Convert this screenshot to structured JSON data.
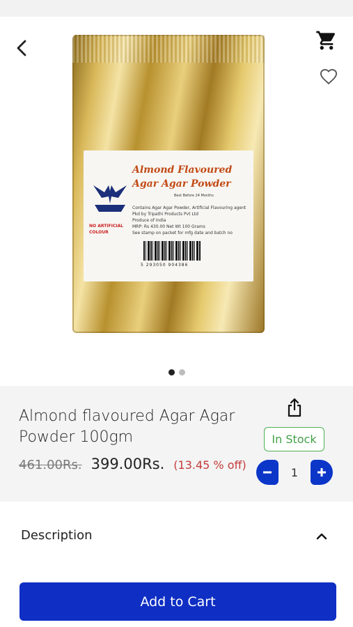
{
  "product": {
    "title": "Almond flavoured Agar Agar Powder 100gm",
    "old_price": "461.00Rs.",
    "price": "399.00Rs.",
    "discount": "(13.45 % off)",
    "stock_status": "In Stock",
    "quantity": "1"
  },
  "image_label": {
    "title": "Almond Flavoured Agar Agar Powder",
    "best_before": "Best Before 24 Months",
    "lines": [
      "Contains Agar Agar Powder, Artificial Flavouring agent",
      "Pkd by Tripathi Products Pvt Ltd",
      "Produce of India",
      "MRP: Rs 430.00   Net Wt 100 Grams",
      "See stamp on packet for mfg date and batch no"
    ],
    "no_artificial": "NO ARTIFICIAL COLOUR",
    "barcode_number": "5 293050 904386"
  },
  "carousel": {
    "total": 2,
    "active": 0
  },
  "icons": {
    "back": "chevron-left-icon",
    "cart": "cart-icon",
    "wishlist": "heart-icon",
    "share": "share-icon",
    "expand": "chevron-up-icon",
    "minus": "minus-icon",
    "plus": "plus-icon"
  },
  "description": {
    "label": "Description"
  },
  "actions": {
    "add_to_cart": "Add to Cart"
  },
  "colors": {
    "primary": "#0e2ec4",
    "stock_green": "#43a047",
    "discount_red": "#c43a3a",
    "info_bg": "#f4f4f4"
  }
}
